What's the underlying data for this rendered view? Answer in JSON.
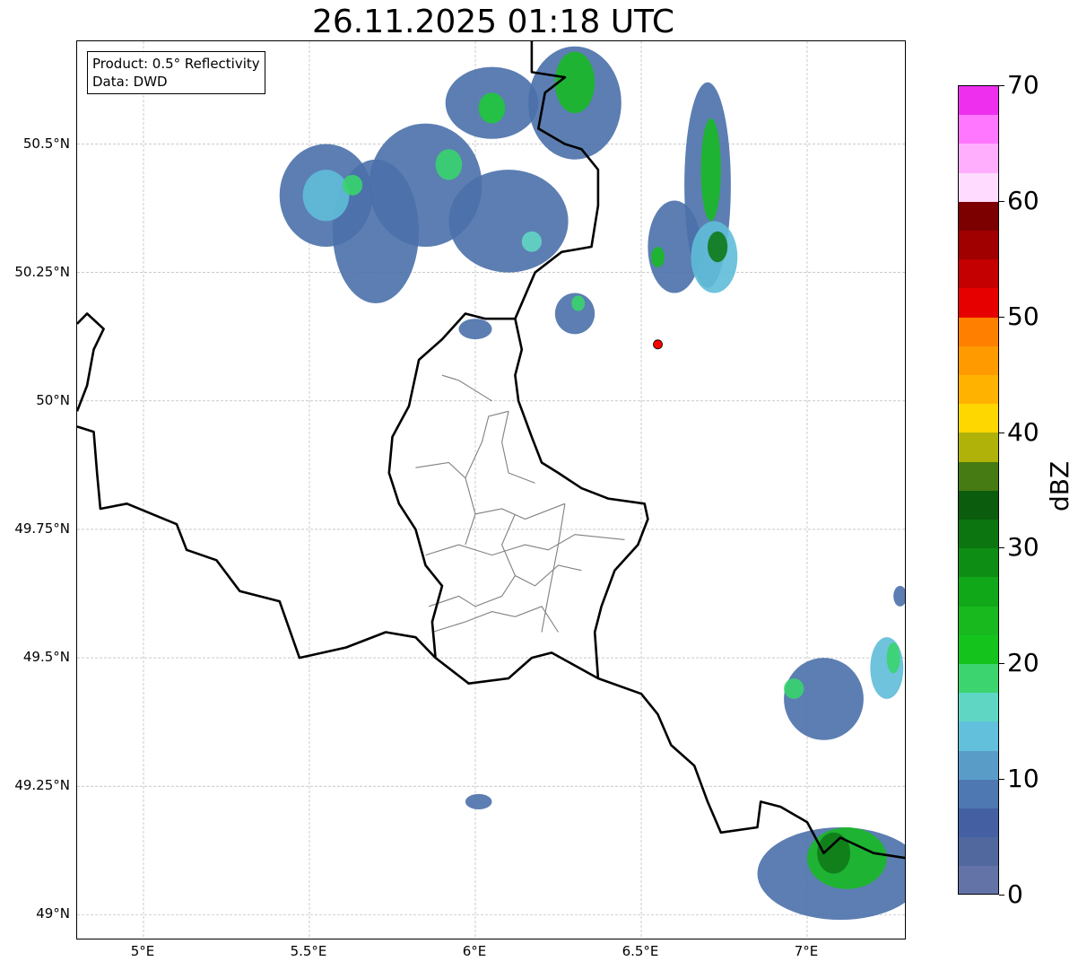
{
  "title": "26.11.2025 01:18 UTC",
  "info": {
    "product": "Product: 0.5° Reflectivity",
    "data": "Data: DWD"
  },
  "map": {
    "extent": {
      "lon_min": 4.8,
      "lon_max": 7.3,
      "lat_min": 48.95,
      "lat_max": 50.7
    },
    "lat_ticks": [
      {
        "value": 50.5,
        "label": "50.5°N"
      },
      {
        "value": 50.25,
        "label": "50.25°N"
      },
      {
        "value": 50.0,
        "label": "50°N"
      },
      {
        "value": 49.75,
        "label": "49.75°N"
      },
      {
        "value": 49.5,
        "label": "49.5°N"
      },
      {
        "value": 49.25,
        "label": "49.25°N"
      },
      {
        "value": 49.0,
        "label": "49°N"
      }
    ],
    "lon_ticks": [
      {
        "value": 5.0,
        "label": "5°E"
      },
      {
        "value": 5.5,
        "label": "5.5°E"
      },
      {
        "value": 6.0,
        "label": "6°E"
      },
      {
        "value": 6.5,
        "label": "6.5°E"
      },
      {
        "value": 7.0,
        "label": "7°E"
      }
    ],
    "marker": {
      "name": "radar-site",
      "lon": 6.55,
      "lat": 50.11,
      "color": "#ff0000"
    },
    "precip_cells": [
      {
        "lon": 5.55,
        "lat": 50.4,
        "rlon": 0.14,
        "rlat": 0.1,
        "color": "#4a70aa"
      },
      {
        "lon": 5.7,
        "lat": 50.33,
        "rlon": 0.13,
        "rlat": 0.14,
        "color": "#4a70aa"
      },
      {
        "lon": 5.55,
        "lat": 50.4,
        "rlon": 0.07,
        "rlat": 0.05,
        "color": "#5fbcd8"
      },
      {
        "lon": 5.63,
        "lat": 50.42,
        "rlon": 0.03,
        "rlat": 0.02,
        "color": "#39d46e"
      },
      {
        "lon": 5.85,
        "lat": 50.42,
        "rlon": 0.17,
        "rlat": 0.12,
        "color": "#4a70aa"
      },
      {
        "lon": 5.92,
        "lat": 50.46,
        "rlon": 0.04,
        "rlat": 0.03,
        "color": "#39d46e"
      },
      {
        "lon": 6.05,
        "lat": 50.58,
        "rlon": 0.14,
        "rlat": 0.07,
        "color": "#4a70aa"
      },
      {
        "lon": 6.05,
        "lat": 50.57,
        "rlon": 0.04,
        "rlat": 0.03,
        "color": "#1fc83a"
      },
      {
        "lon": 6.3,
        "lat": 50.58,
        "rlon": 0.14,
        "rlat": 0.11,
        "color": "#4a70aa"
      },
      {
        "lon": 6.3,
        "lat": 50.62,
        "rlon": 0.06,
        "rlat": 0.06,
        "color": "#18b925"
      },
      {
        "lon": 6.1,
        "lat": 50.35,
        "rlon": 0.18,
        "rlat": 0.1,
        "color": "#4a70aa"
      },
      {
        "lon": 6.17,
        "lat": 50.31,
        "rlon": 0.03,
        "rlat": 0.02,
        "color": "#62d6c2"
      },
      {
        "lon": 6.0,
        "lat": 50.14,
        "rlon": 0.05,
        "rlat": 0.02,
        "color": "#4a70aa"
      },
      {
        "lon": 6.3,
        "lat": 50.17,
        "rlon": 0.06,
        "rlat": 0.04,
        "color": "#4a70aa"
      },
      {
        "lon": 6.31,
        "lat": 50.19,
        "rlon": 0.02,
        "rlat": 0.015,
        "color": "#39d46e"
      },
      {
        "lon": 6.7,
        "lat": 50.42,
        "rlon": 0.07,
        "rlat": 0.2,
        "color": "#4a70aa"
      },
      {
        "lon": 6.71,
        "lat": 50.45,
        "rlon": 0.03,
        "rlat": 0.1,
        "color": "#18b925"
      },
      {
        "lon": 6.6,
        "lat": 50.3,
        "rlon": 0.08,
        "rlat": 0.09,
        "color": "#4a70aa"
      },
      {
        "lon": 6.72,
        "lat": 50.28,
        "rlon": 0.07,
        "rlat": 0.07,
        "color": "#5fbcd8"
      },
      {
        "lon": 6.73,
        "lat": 50.3,
        "rlon": 0.03,
        "rlat": 0.03,
        "color": "#0f7a18"
      },
      {
        "lon": 6.55,
        "lat": 50.28,
        "rlon": 0.02,
        "rlat": 0.02,
        "color": "#18b925"
      },
      {
        "lon": 7.05,
        "lat": 49.42,
        "rlon": 0.12,
        "rlat": 0.08,
        "color": "#4a70aa"
      },
      {
        "lon": 6.96,
        "lat": 49.44,
        "rlon": 0.03,
        "rlat": 0.02,
        "color": "#39d46e"
      },
      {
        "lon": 7.24,
        "lat": 49.48,
        "rlon": 0.05,
        "rlat": 0.06,
        "color": "#5fbcd8"
      },
      {
        "lon": 7.26,
        "lat": 49.5,
        "rlon": 0.02,
        "rlat": 0.03,
        "color": "#39d46e"
      },
      {
        "lon": 7.1,
        "lat": 49.08,
        "rlon": 0.25,
        "rlat": 0.09,
        "color": "#4a70aa"
      },
      {
        "lon": 7.12,
        "lat": 49.11,
        "rlon": 0.12,
        "rlat": 0.06,
        "color": "#18b925"
      },
      {
        "lon": 7.08,
        "lat": 49.12,
        "rlon": 0.05,
        "rlat": 0.04,
        "color": "#0f7a18"
      },
      {
        "lon": 7.28,
        "lat": 49.62,
        "rlon": 0.02,
        "rlat": 0.02,
        "color": "#4a70aa"
      },
      {
        "lon": 6.01,
        "lat": 49.22,
        "rlon": 0.04,
        "rlat": 0.015,
        "color": "#4a70aa"
      }
    ],
    "borders": [
      [
        [
          4.8,
          50.15
        ],
        [
          4.83,
          50.17
        ],
        [
          4.88,
          50.14
        ],
        [
          4.85,
          50.1
        ],
        [
          4.83,
          50.03
        ],
        [
          4.8,
          49.98
        ]
      ],
      [
        [
          4.8,
          49.95
        ],
        [
          4.85,
          49.94
        ],
        [
          4.86,
          49.86
        ],
        [
          4.87,
          49.79
        ],
        [
          4.95,
          49.8
        ],
        [
          5.1,
          49.76
        ],
        [
          5.13,
          49.71
        ],
        [
          5.22,
          49.69
        ],
        [
          5.29,
          49.63
        ],
        [
          5.41,
          49.61
        ],
        [
          5.47,
          49.5
        ],
        [
          5.61,
          49.52
        ],
        [
          5.73,
          49.55
        ],
        [
          5.82,
          49.54
        ],
        [
          5.88,
          49.5
        ],
        [
          5.98,
          49.45
        ],
        [
          6.1,
          49.46
        ],
        [
          6.17,
          49.5
        ],
        [
          6.23,
          49.51
        ],
        [
          6.37,
          49.46
        ],
        [
          6.5,
          49.43
        ],
        [
          6.55,
          49.39
        ],
        [
          6.59,
          49.33
        ],
        [
          6.66,
          49.29
        ],
        [
          6.7,
          49.22
        ],
        [
          6.74,
          49.16
        ],
        [
          6.85,
          49.17
        ],
        [
          6.86,
          49.22
        ],
        [
          6.92,
          49.21
        ],
        [
          7.0,
          49.18
        ],
        [
          7.05,
          49.12
        ],
        [
          7.1,
          49.15
        ],
        [
          7.2,
          49.12
        ],
        [
          7.3,
          49.11
        ]
      ],
      [
        [
          5.88,
          49.5
        ],
        [
          5.87,
          49.57
        ],
        [
          5.9,
          49.64
        ],
        [
          5.85,
          49.68
        ],
        [
          5.82,
          49.75
        ],
        [
          5.77,
          49.8
        ],
        [
          5.74,
          49.86
        ],
        [
          5.75,
          49.93
        ],
        [
          5.8,
          49.99
        ],
        [
          5.83,
          50.08
        ],
        [
          5.9,
          50.12
        ],
        [
          5.97,
          50.17
        ],
        [
          6.03,
          50.16
        ],
        [
          6.12,
          50.16
        ],
        [
          6.14,
          50.1
        ],
        [
          6.12,
          50.05
        ],
        [
          6.13,
          50.0
        ],
        [
          6.17,
          49.93
        ],
        [
          6.2,
          49.88
        ],
        [
          6.25,
          49.86
        ],
        [
          6.32,
          49.83
        ],
        [
          6.4,
          49.81
        ],
        [
          6.51,
          49.8
        ],
        [
          6.52,
          49.77
        ],
        [
          6.49,
          49.72
        ],
        [
          6.42,
          49.67
        ],
        [
          6.38,
          49.6
        ],
        [
          6.36,
          49.55
        ],
        [
          6.37,
          49.46
        ]
      ],
      [
        [
          6.12,
          50.16
        ],
        [
          6.18,
          50.25
        ],
        [
          6.26,
          50.29
        ],
        [
          6.35,
          50.3
        ],
        [
          6.37,
          50.38
        ],
        [
          6.37,
          50.45
        ],
        [
          6.32,
          50.49
        ],
        [
          6.27,
          50.5
        ],
        [
          6.19,
          50.53
        ],
        [
          6.21,
          50.6
        ],
        [
          6.27,
          50.63
        ],
        [
          6.17,
          50.64
        ],
        [
          6.17,
          50.7
        ]
      ]
    ],
    "cantons": [
      [
        [
          5.82,
          49.87
        ],
        [
          5.92,
          49.88
        ],
        [
          5.97,
          49.85
        ],
        [
          6.0,
          49.78
        ],
        [
          6.08,
          49.79
        ],
        [
          6.15,
          49.77
        ],
        [
          6.27,
          49.8
        ]
      ],
      [
        [
          5.97,
          49.85
        ],
        [
          6.02,
          49.92
        ],
        [
          6.04,
          49.97
        ],
        [
          6.1,
          49.98
        ]
      ],
      [
        [
          5.85,
          49.7
        ],
        [
          5.95,
          49.72
        ],
        [
          6.05,
          49.7
        ],
        [
          6.15,
          49.72
        ],
        [
          6.22,
          49.71
        ],
        [
          6.3,
          49.74
        ],
        [
          6.45,
          49.73
        ]
      ],
      [
        [
          5.97,
          49.72
        ],
        [
          6.0,
          49.78
        ]
      ],
      [
        [
          5.86,
          49.6
        ],
        [
          5.95,
          49.62
        ],
        [
          6.0,
          49.6
        ],
        [
          6.08,
          49.62
        ],
        [
          6.12,
          49.66
        ],
        [
          6.18,
          49.64
        ],
        [
          6.25,
          49.68
        ],
        [
          6.32,
          49.67
        ]
      ],
      [
        [
          5.87,
          49.55
        ],
        [
          5.97,
          49.57
        ],
        [
          6.05,
          49.59
        ],
        [
          6.12,
          49.58
        ],
        [
          6.2,
          49.6
        ],
        [
          6.25,
          49.55
        ]
      ],
      [
        [
          6.12,
          49.66
        ],
        [
          6.08,
          49.72
        ],
        [
          6.12,
          49.78
        ]
      ],
      [
        [
          6.27,
          49.8
        ],
        [
          6.25,
          49.72
        ],
        [
          6.22,
          49.62
        ],
        [
          6.2,
          49.55
        ]
      ],
      [
        [
          5.9,
          50.05
        ],
        [
          5.95,
          50.04
        ],
        [
          6.0,
          50.02
        ],
        [
          6.05,
          50.0
        ]
      ],
      [
        [
          6.1,
          49.98
        ],
        [
          6.08,
          49.92
        ],
        [
          6.1,
          49.86
        ],
        [
          6.18,
          49.84
        ]
      ]
    ]
  },
  "colorbar": {
    "unit": "dBZ",
    "min": 0,
    "max": 70,
    "ticks": [
      {
        "value": 0,
        "label": "0"
      },
      {
        "value": 10,
        "label": "10"
      },
      {
        "value": 20,
        "label": "20"
      },
      {
        "value": 30,
        "label": "30"
      },
      {
        "value": 40,
        "label": "40"
      },
      {
        "value": 50,
        "label": "50"
      },
      {
        "value": 60,
        "label": "60"
      },
      {
        "value": 70,
        "label": "70"
      }
    ],
    "colors": [
      "#6373a8",
      "#51689e",
      "#4460a2",
      "#4d78b2",
      "#5a9cc8",
      "#62c0dc",
      "#5fd6c4",
      "#3cd46e",
      "#14c41c",
      "#18b91e",
      "#10a818",
      "#0e8d14",
      "#0c7510",
      "#0b5c0c",
      "#467a12",
      "#b0b20a",
      "#ffd700",
      "#ffb300",
      "#ff9a00",
      "#ff8000",
      "#e60000",
      "#c40000",
      "#a00000",
      "#7d0000",
      "#ffdcff",
      "#ffaefe",
      "#ff76ff",
      "#ee30ee"
    ]
  }
}
